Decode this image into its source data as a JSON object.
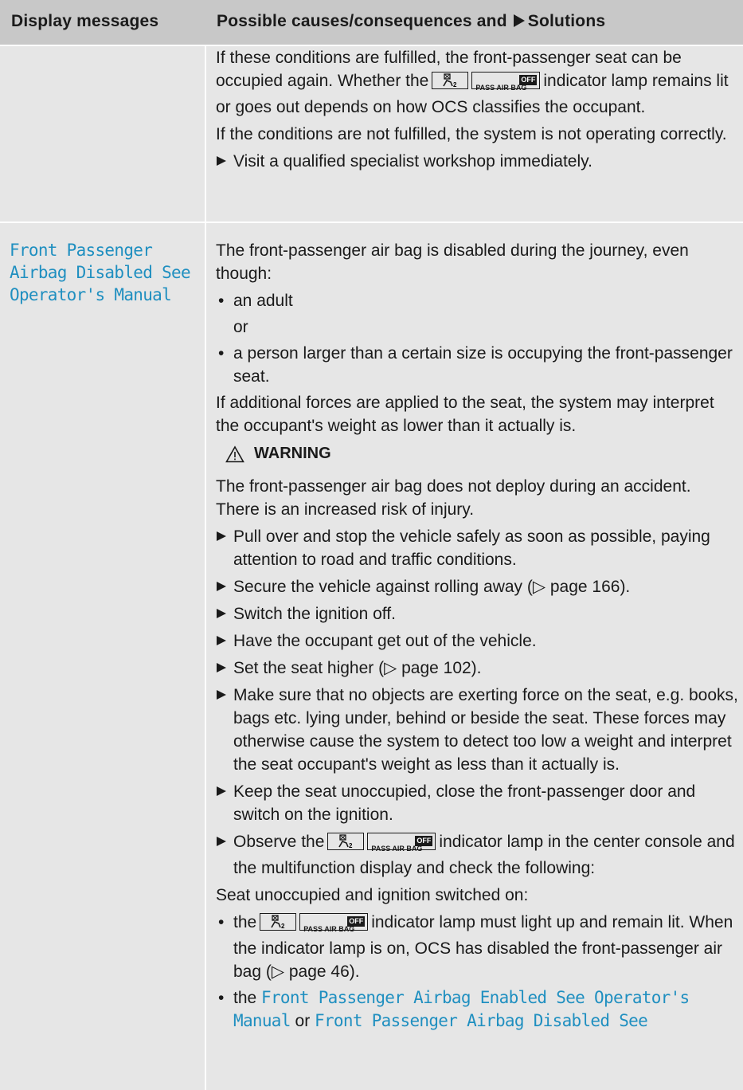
{
  "header": {
    "col1": "Display messages",
    "col2": "Possible causes/consequences and",
    "col2_solutions": "Solutions"
  },
  "row1": {
    "p1_a": "If these conditions are fulfilled, the front-passenger seat can be occupied again. Whether the",
    "p1_b": "indicator lamp remains lit or goes out depends on how OCS classifies the occupant.",
    "p2": "If the conditions are not fulfilled, the system is not operating correctly.",
    "step1": "Visit a qualified specialist workshop immediately."
  },
  "row2": {
    "message": "Front Passenger Airbag Disabled See Operator's Manual",
    "intro": "The front-passenger air bag is disabled during the journey, even though:",
    "bullet1": "an adult",
    "or": "or",
    "bullet2": "a person larger than a certain size is occupying the front-passenger seat.",
    "p_forces": "If additional forces are applied to the seat, the system may interpret the occupant's weight as lower than it actually is.",
    "warning_label": "WARNING",
    "warn_p1": "The front-passenger air bag does not deploy during an accident.",
    "warn_p2": "There is an increased risk of injury.",
    "steps": [
      "Pull over and stop the vehicle safely as soon as possible, paying attention to road and traffic conditions.",
      "Secure the vehicle against rolling away (▷ page 166).",
      "Switch the ignition off.",
      "Have the occupant get out of the vehicle.",
      "Set the seat higher (▷ page 102).",
      "Make sure that no objects are exerting force on the seat, e.g. books, bags etc. lying under, behind or beside the seat. These forces may otherwise cause the system to detect too low a weight and interpret the seat occupant's weight as less than it actually is.",
      "Keep the seat unoccupied, close the front-passenger door and switch on the ignition."
    ],
    "step_observe_a": "Observe the",
    "step_observe_b": "indicator lamp in the center console and the multifunction display and check the following:",
    "seat_unoccupied": "Seat unoccupied and ignition switched on:",
    "b3_a": "the",
    "b3_b": "indicator lamp must light up and remain lit. When the indicator lamp is on, OCS has disabled the front-passenger air bag (▷ page 46).",
    "b4_a": "the",
    "b4_msg1": "Front Passenger Airbag Enabled See Operator's Manual",
    "b4_or": "or",
    "b4_msg2": "Front Passenger Airbag Disabled See"
  },
  "lamp": {
    "pass_air_bag": "PASS AIR BAG",
    "off": "OFF"
  },
  "colors": {
    "header_bg": "#c8c8c8",
    "cell_bg": "#e6e6e6",
    "display_message": "#1f8fc0"
  }
}
